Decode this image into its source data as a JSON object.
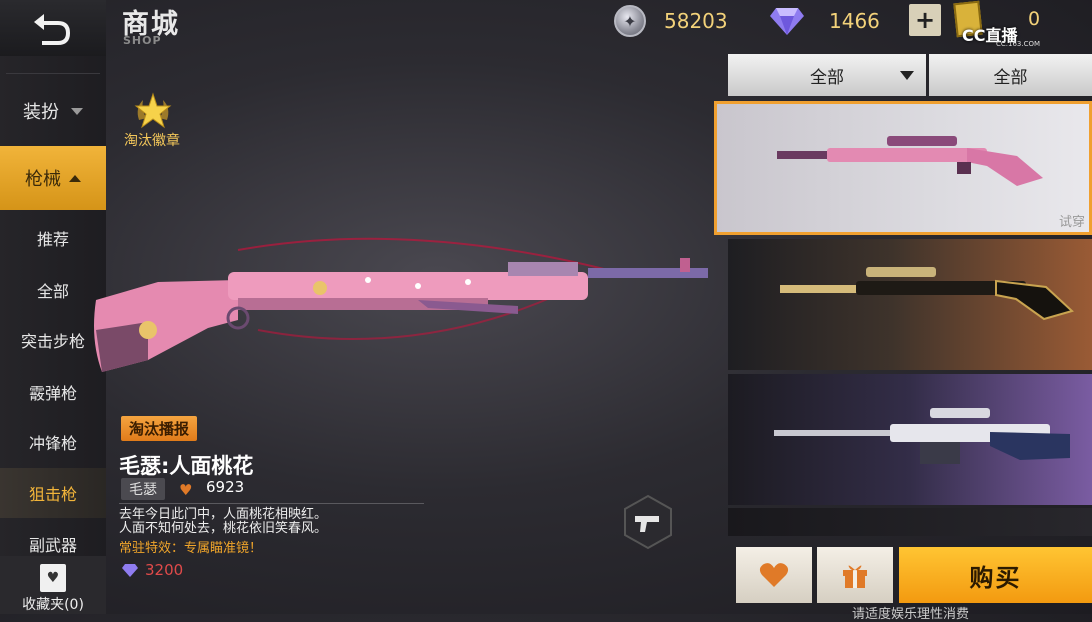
{
  "header": {
    "title": "商城",
    "subtitle": "SHOP",
    "coins": "58203",
    "diamonds": "1466",
    "plus_label": "+",
    "tickets": "0",
    "watermark": "CC直播",
    "watermark_sub": "CC.163.COM"
  },
  "sidebar": {
    "categories": [
      {
        "label": "装扮"
      },
      {
        "label": "枪械"
      }
    ],
    "subitems": [
      {
        "label": "推荐"
      },
      {
        "label": "全部"
      },
      {
        "label": "突击步枪"
      },
      {
        "label": "霰弹枪"
      },
      {
        "label": "冲锋枪"
      },
      {
        "label": "狙击枪"
      },
      {
        "label": "副武器"
      }
    ],
    "favorites_label": "收藏夹(0)"
  },
  "badge": {
    "label": "淘汰徽章"
  },
  "weapon": {
    "tag": "淘汰播报",
    "name": "毛瑟:人面桃花",
    "type": "毛瑟",
    "likes": "6923",
    "desc_line1": "去年今日此门中，人面桃花相映红。",
    "desc_line2": "人面不知何处去，桃花依旧笑春风。",
    "special": "常驻特效：专属瞄准镜！",
    "price": "3200"
  },
  "filters": {
    "first": "全部",
    "second": "全部"
  },
  "cards": {
    "try_label": "试穿"
  },
  "actions": {
    "buy_label": "购买",
    "hint": "请适度娱乐理性消费"
  },
  "colors": {
    "accent": "#f2b53a",
    "price": "#e04a4a",
    "buy": "#f7b020"
  }
}
